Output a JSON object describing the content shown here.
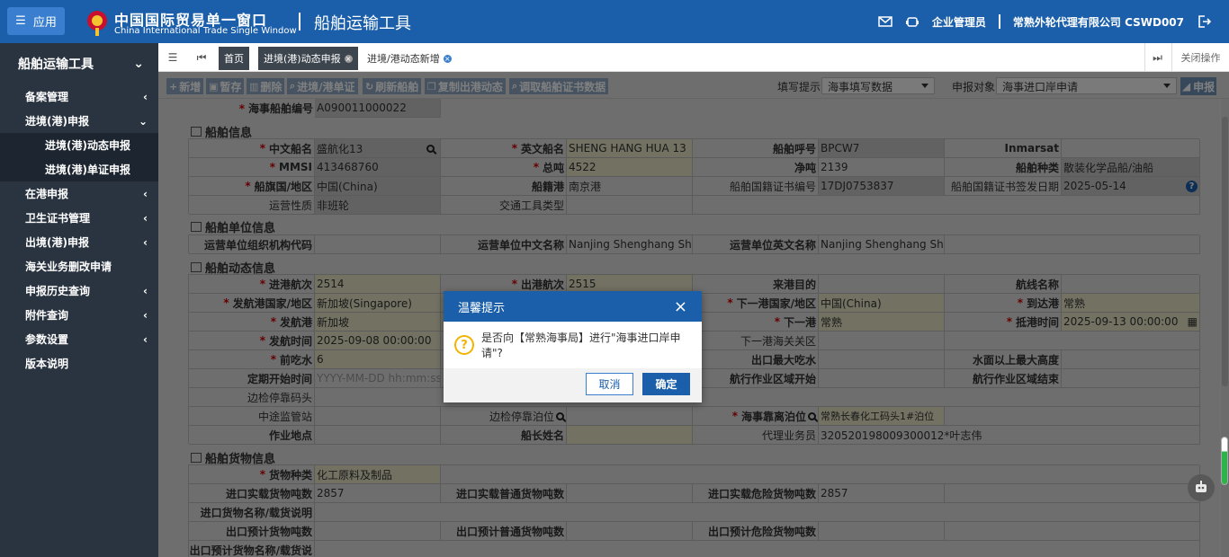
{
  "topbar": {
    "app_label": "应用",
    "brand_cn": "中国国际贸易单一窗口",
    "brand_en": "China International Trade Single Window",
    "title": "船舶运输工具",
    "user_role": "企业管理员",
    "company": "常熟外轮代理有限公司 CSWD007",
    "colors": {
      "header_bg": "#1b5faa",
      "sidebar_bg": "#2a3441"
    }
  },
  "sidebar": {
    "title": "船舶运输工具",
    "items": [
      {
        "label": "备案管理",
        "arrow": "‹"
      },
      {
        "label": "进境(港)申报",
        "arrow": "⌄"
      },
      {
        "label": "进境(港)动态申报",
        "sub": true
      },
      {
        "label": "进境(港)单证申报",
        "sub": true
      },
      {
        "label": "在港申报",
        "arrow": "‹"
      },
      {
        "label": "卫生证书管理",
        "arrow": "‹"
      },
      {
        "label": "出境(港)申报",
        "arrow": "‹"
      },
      {
        "label": "海关业务删改申请",
        "arrow": ""
      },
      {
        "label": "申报历史查询",
        "arrow": "‹"
      },
      {
        "label": "附件查询",
        "arrow": "‹"
      },
      {
        "label": "参数设置",
        "arrow": "‹"
      },
      {
        "label": "版本说明",
        "arrow": ""
      }
    ]
  },
  "tabs": {
    "home": "首页",
    "tab1": "进境(港)动态申报",
    "tab2": "进境/港动态新增",
    "close_ops": "关闭操作"
  },
  "toolbar": {
    "add": "新增",
    "save": "暂存",
    "delete": "删除",
    "entry_doc": "进境/港单证",
    "refresh_ship": "刷新船舶",
    "copy_exit": "复制出港动态",
    "fetch_cert": "调取船舶证书数据",
    "fill_hint_label": "填写提示",
    "fill_hint_value": "海事填写数据",
    "target_label": "申报对象",
    "target_value": "海事进口岸申请",
    "submit": "申报"
  },
  "form": {
    "msa_no_label": "海事船舶编号",
    "msa_no": "A090011000022",
    "sec_ship": "船舶信息",
    "cn_name_label": "中文船名",
    "cn_name": "盛航化13",
    "en_name_label": "英文船名",
    "en_name": "SHENG HANG HUA 13",
    "call_sign_label": "船舶呼号",
    "call_sign": "BPCW7",
    "inmarsat_label": "Inmarsat",
    "mmsi_label": "MMSI",
    "mmsi": "413468760",
    "gross_label": "总吨",
    "gross": "4522",
    "net_label": "净吨",
    "net": "2139",
    "type_label": "船舶种类",
    "type": "散装化学品船/油船",
    "flag_label": "船旗国/地区",
    "flag": "中国(China)",
    "port_reg_label": "船籍港",
    "port_reg": "南京港",
    "cert_no_label": "船舶国籍证书编号",
    "cert_no": "17DJ0753837",
    "cert_date_label": "船舶国籍证书签发日期",
    "cert_date": "2025-05-14",
    "op_nature_label": "运营性质",
    "op_nature": "非班轮",
    "vehicle_type_label": "交通工具类型",
    "sec_unit": "船舶单位信息",
    "org_code_label": "运营单位组织机构代码",
    "unit_cn_label": "运营单位中文名称",
    "unit_cn": "Nanjing Shenghang Shipp",
    "unit_en_label": "运营单位英文名称",
    "unit_en": "Nanjing Shenghang Shipp",
    "sec_dyn": "船舶动态信息",
    "in_voy_label": "进港航次",
    "in_voy": "2514",
    "out_voy_label": "出港航次",
    "out_voy": "2515",
    "purpose_label": "来港目的",
    "route_label": "航线名称",
    "dep_country_label": "发航港国家/地区",
    "dep_country": "新加坡(Singapore)",
    "next_country_label": "下一港国家/地区",
    "next_country": "中国(China)",
    "arr_port_label": "到达港",
    "arr_port": "常熟",
    "dep_port_label": "发航港",
    "dep_port": "新加坡",
    "next_port_label": "下一港",
    "next_port": "常熟",
    "arr_time_label": "抵港时间",
    "arr_time": "2025-09-13 00:00:00",
    "dep_time_label": "发航时间",
    "dep_time": "2025-09-08 00:00:00",
    "next_customs_label": "下一港海关关区",
    "draft_label": "前吃水",
    "draft": "6",
    "max_draft_label": "出口最大吃水",
    "max_height_label": "水面以上最大高度",
    "period_start_label": "定期开始时间",
    "period_start_ph": "YYYY-MM-DD hh:mm:ss",
    "zone_start_label": "航行作业区域开始",
    "zone_end_label": "航行作业区域结束",
    "border_dock_label": "边检停靠码头",
    "transit_label": "中途监管站",
    "border_berth_label": "边检停靠泊位",
    "msa_berth_label": "海事靠离泊位",
    "msa_berth": "常熟长春化工码头1#泊位",
    "work_place_label": "作业地点",
    "captain_label": "船长姓名",
    "agent_label": "代理业务员",
    "agent": "320520198009300012*叶志伟",
    "sec_cargo": "船舶货物信息",
    "cargo_type_label": "货物种类",
    "cargo_type": "化工原料及制品",
    "imp_ton_label": "进口实载货物吨数",
    "imp_ton": "2857",
    "imp_gen_label": "进口实载普通货物吨数",
    "imp_dg_label": "进口实载危险货物吨数",
    "imp_dg": "2857",
    "imp_desc_label": "进口货物名称/载货说明",
    "exp_ton_label": "出口预计货物吨数",
    "exp_gen_label": "出口预计普通货物吨数",
    "exp_dg_label": "出口预计危险货物吨数",
    "exp_desc_label": "出口预计货物名称/载货说"
  },
  "dialog": {
    "title": "温馨提示",
    "message": "是否向【常熟海事局】进行\"海事进口岸申请\"?",
    "cancel": "取消",
    "ok": "确定"
  }
}
